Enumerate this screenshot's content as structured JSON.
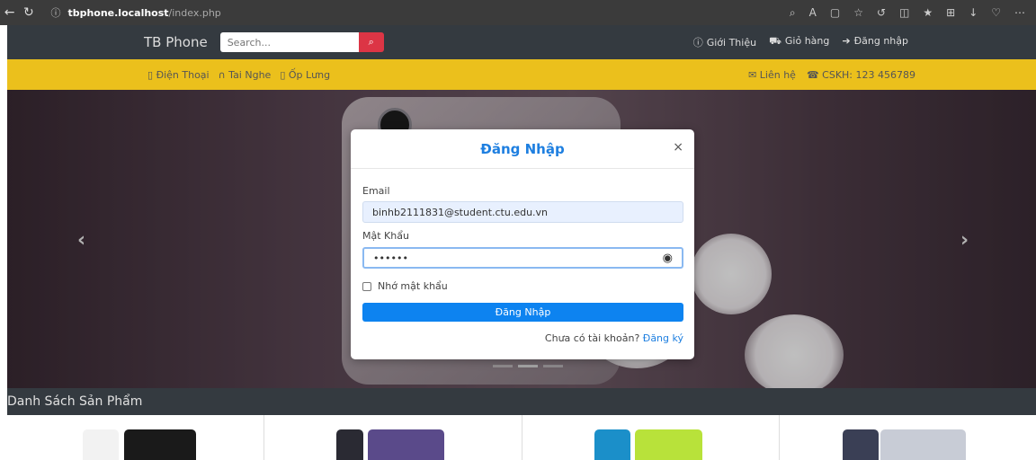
{
  "browser": {
    "back_icon": "←",
    "reload_icon": "↻",
    "info_icon": "ⓘ",
    "url_host": "tbphone.localhost",
    "url_path": "/index.php",
    "toolbar_icons": [
      "read-aloud-icon",
      "text-size-icon",
      "split-screen-icon",
      "favorite-icon",
      "refresh-icon",
      "sidebar-icon",
      "favorites-icon",
      "collections-icon",
      "download-icon",
      "extensions-icon",
      "more-icon"
    ]
  },
  "navbar": {
    "brand": "TB Phone",
    "search_placeholder": "Search...",
    "search_icon": "search-icon",
    "links": [
      {
        "label": "Giới Thiệu",
        "icon": "info-icon"
      },
      {
        "label": "Giỏ hàng",
        "icon": "cart-icon"
      },
      {
        "label": "Đăng nhập",
        "icon": "sign-in-icon"
      }
    ]
  },
  "subnav": {
    "categories": [
      {
        "label": "Điện Thoại",
        "icon": "phone-icon"
      },
      {
        "label": "Tai Nghe",
        "icon": "headphones-icon"
      },
      {
        "label": "Ốp Lưng",
        "icon": "case-icon"
      }
    ],
    "contact": {
      "label": "Liên hệ",
      "icon": "envelope-icon"
    },
    "hotline": {
      "label": "CSKH: 123 456789",
      "icon": "phone-call-icon"
    }
  },
  "carousel": {
    "prev_icon": "‹",
    "next_icon": "›",
    "slides": 3,
    "active_slide": 2
  },
  "login_modal": {
    "title": "Đăng Nhập",
    "close_icon": "×",
    "email_label": "Email",
    "email_value": "binhb2111831@student.ctu.edu.vn",
    "password_label": "Mật Khẩu",
    "password_value": "••••••",
    "eye_icon": "eye-icon",
    "remember_label": "Nhớ mật khẩu",
    "remember_checked": false,
    "submit_label": "Đăng Nhập",
    "signup_prompt": "Chưa có tài khoản?",
    "signup_link": "Đăng ký"
  },
  "products_section": {
    "title": "Danh Sách Sản Phẩm"
  },
  "colors": {
    "navbar_bg": "#343a40",
    "subnav_bg": "#ebc01c",
    "accent_blue": "#0d83f0",
    "search_btn": "#dc3545"
  }
}
